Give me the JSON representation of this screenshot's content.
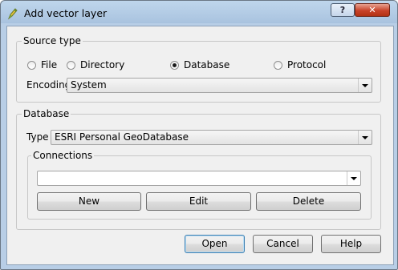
{
  "window": {
    "title": "Add vector layer",
    "help_glyph": "?",
    "close_glyph": "✕",
    "icon": "qgis-pencil-icon"
  },
  "source_type": {
    "title": "Source type",
    "options": [
      {
        "label": "File",
        "checked": false
      },
      {
        "label": "Directory",
        "checked": false
      },
      {
        "label": "Database",
        "checked": true
      },
      {
        "label": "Protocol",
        "checked": false
      }
    ],
    "encoding_label": "Encoding",
    "encoding_value": "System"
  },
  "database": {
    "title": "Database",
    "type_label": "Type",
    "type_value": "ESRI Personal GeoDatabase",
    "connections": {
      "title": "Connections",
      "value": "",
      "new_label": "New",
      "edit_label": "Edit",
      "delete_label": "Delete"
    }
  },
  "footer": {
    "open_label": "Open",
    "cancel_label": "Cancel",
    "help_label": "Help"
  }
}
